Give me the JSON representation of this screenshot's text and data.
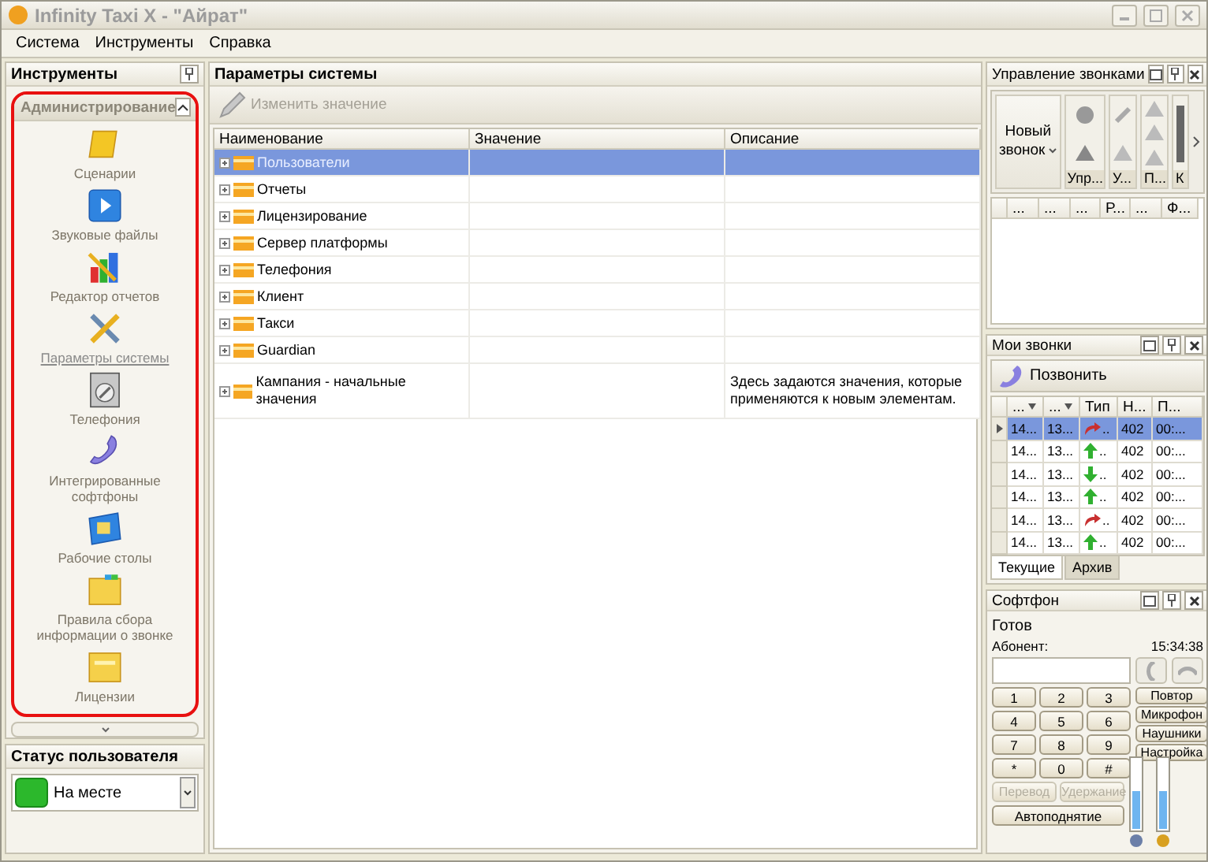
{
  "window": {
    "title": "Infinity Taxi X - \"Айрат\""
  },
  "menu": [
    "Система",
    "Инструменты",
    "Справка"
  ],
  "tools_panel": {
    "title": "Инструменты",
    "group": {
      "title": "Администрирование",
      "expanded": true
    },
    "items": [
      {
        "label": "Сценарии",
        "kind": "scroll",
        "selected": false
      },
      {
        "label": "Звуковые файлы",
        "kind": "play",
        "selected": false
      },
      {
        "label": "Редактор отчетов",
        "kind": "chart",
        "selected": false
      },
      {
        "label": "Параметры системы",
        "kind": "tools",
        "selected": true
      },
      {
        "label": "Телефония",
        "kind": "dial",
        "selected": false
      },
      {
        "label": "Интегрированные софтфоны",
        "kind": "phone",
        "selected": false
      },
      {
        "label": "Рабочие столы",
        "kind": "desk",
        "selected": false
      },
      {
        "label": "Правила сбора информации о звонке",
        "kind": "folder",
        "selected": false
      },
      {
        "label": "Лицензии",
        "kind": "license",
        "selected": false
      }
    ]
  },
  "user_status": {
    "title": "Статус пользователя",
    "value": "На месте"
  },
  "params": {
    "title": "Параметры системы",
    "edit_button": {
      "label": "Изменить значение",
      "disabled": true
    },
    "columns": [
      "Наименование",
      "Значение",
      "Описание"
    ],
    "rows": [
      {
        "name": "Пользователи",
        "selected": true
      },
      {
        "name": "Отчеты",
        "selected": false
      },
      {
        "name": "Лицензирование",
        "selected": false
      },
      {
        "name": "Сервер платформы",
        "selected": false
      },
      {
        "name": "Телефония",
        "selected": false
      },
      {
        "name": "Клиент",
        "selected": false
      },
      {
        "name": "Такси",
        "selected": false
      },
      {
        "name": "Guardian",
        "selected": false
      },
      {
        "name": "Кампания - начальные значения",
        "selected": false,
        "description": "Здесь задаются значения, которые применяются к новым элементам."
      }
    ]
  },
  "call_control": {
    "title": "Управление звонками",
    "new_call": "Новый звонок",
    "groups": [
      "Упр...",
      "У...",
      "П...",
      "К"
    ],
    "columns": [
      "...",
      "...",
      "...",
      "Р...",
      "...",
      "Ф..."
    ]
  },
  "my_calls": {
    "title": "Мои звонки",
    "call_button": "Позвонить",
    "columns": [
      {
        "label": "...",
        "sorted": true
      },
      {
        "label": "...",
        "sorted": true
      },
      {
        "label": "Тип",
        "sorted": false
      },
      {
        "label": "Н...",
        "sorted": false
      },
      {
        "label": "П...",
        "sorted": false
      }
    ],
    "rows": [
      {
        "date": "14...",
        "id": "13...",
        "kind": "redirect",
        "type": "..",
        "number": "402",
        "time": "00:...",
        "selected": true
      },
      {
        "date": "14...",
        "id": "13...",
        "kind": "up",
        "type": "..",
        "number": "402",
        "time": "00:...",
        "selected": false
      },
      {
        "date": "14...",
        "id": "13...",
        "kind": "down",
        "type": "..",
        "number": "402",
        "time": "00:...",
        "selected": false
      },
      {
        "date": "14...",
        "id": "13...",
        "kind": "up",
        "type": "..",
        "number": "402",
        "time": "00:...",
        "selected": false
      },
      {
        "date": "14...",
        "id": "13...",
        "kind": "redirect",
        "type": "..",
        "number": "402",
        "time": "00:...",
        "selected": false
      },
      {
        "date": "14...",
        "id": "13...",
        "kind": "up",
        "type": "..",
        "number": "402",
        "time": "00:...",
        "selected": false
      }
    ],
    "tabs": [
      {
        "label": "Текущие",
        "selected": true
      },
      {
        "label": "Архив",
        "selected": false
      }
    ]
  },
  "softphone": {
    "title": "Софтфон",
    "status": "Готов",
    "subscriber_label": "Абонент:",
    "time": "15:34:38",
    "keys": [
      "1",
      "2",
      "3",
      "4",
      "5",
      "6",
      "7",
      "8",
      "9",
      "*",
      "0",
      "#"
    ],
    "side_buttons": [
      "Повтор",
      "Микрофон",
      "Наушники",
      "Настройка"
    ],
    "actions": [
      {
        "label": "Перевод",
        "disabled": true
      },
      {
        "label": "Удержание",
        "disabled": true
      }
    ],
    "auto_answer": "Автоподнятие",
    "speaker": {
      "level": 0.55
    },
    "mic": {
      "level": 0.55
    }
  }
}
